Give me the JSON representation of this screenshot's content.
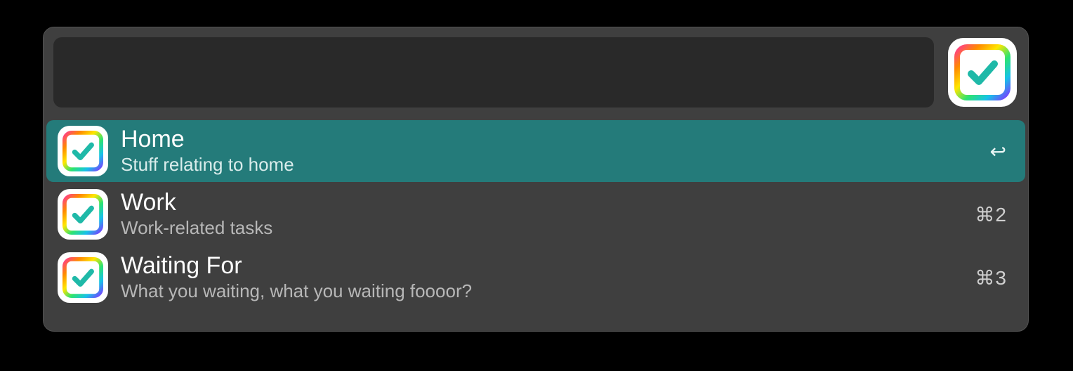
{
  "search": {
    "value": "",
    "placeholder": ""
  },
  "app_icon_name": "checkmark-app-icon",
  "results": [
    {
      "title": "Home",
      "subtitle": "Stuff relating to home",
      "shortcut": "↩",
      "selected": true
    },
    {
      "title": "Work",
      "subtitle": "Work-related tasks",
      "shortcut": "⌘2",
      "selected": false
    },
    {
      "title": "Waiting For",
      "subtitle": "What you waiting, what you waiting foooor?",
      "shortcut": "⌘3",
      "selected": false
    }
  ]
}
